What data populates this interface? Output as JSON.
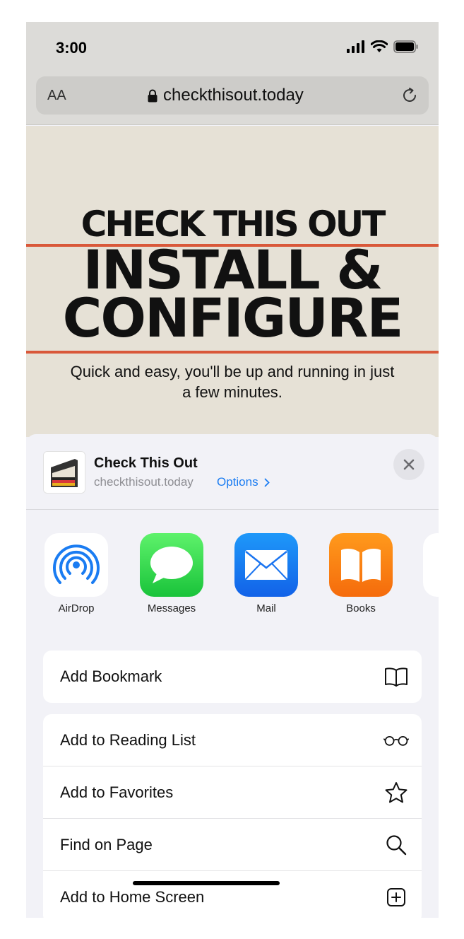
{
  "status_bar": {
    "time": "3:00"
  },
  "address_bar": {
    "text_size_label": "AA",
    "url": "checkthisout.today"
  },
  "webpage": {
    "kicker": "CHECK THIS OUT",
    "headline_line1": "INSTALL &",
    "headline_line2": "CONFIGURE",
    "subtitle": "Quick and easy, you'll be up and running in just a few minutes."
  },
  "share_sheet": {
    "title": "Check This Out",
    "url": "checkthisout.today",
    "options_label": "Options",
    "apps": [
      {
        "label": "AirDrop",
        "icon": "airdrop-icon"
      },
      {
        "label": "Messages",
        "icon": "messages-icon"
      },
      {
        "label": "Mail",
        "icon": "mail-icon"
      },
      {
        "label": "Books",
        "icon": "books-icon"
      }
    ],
    "actions_group1": [
      {
        "label": "Add Bookmark",
        "icon": "book-icon"
      }
    ],
    "actions_group2": [
      {
        "label": "Add to Reading List",
        "icon": "glasses-icon"
      },
      {
        "label": "Add to Favorites",
        "icon": "star-icon"
      },
      {
        "label": "Find on Page",
        "icon": "search-icon"
      },
      {
        "label": "Add to Home Screen",
        "icon": "plus-square-icon"
      }
    ]
  },
  "colors": {
    "accent": "#1a7cf2",
    "hero_rule": "#d9583a",
    "page_background": "#e6e1d6"
  }
}
